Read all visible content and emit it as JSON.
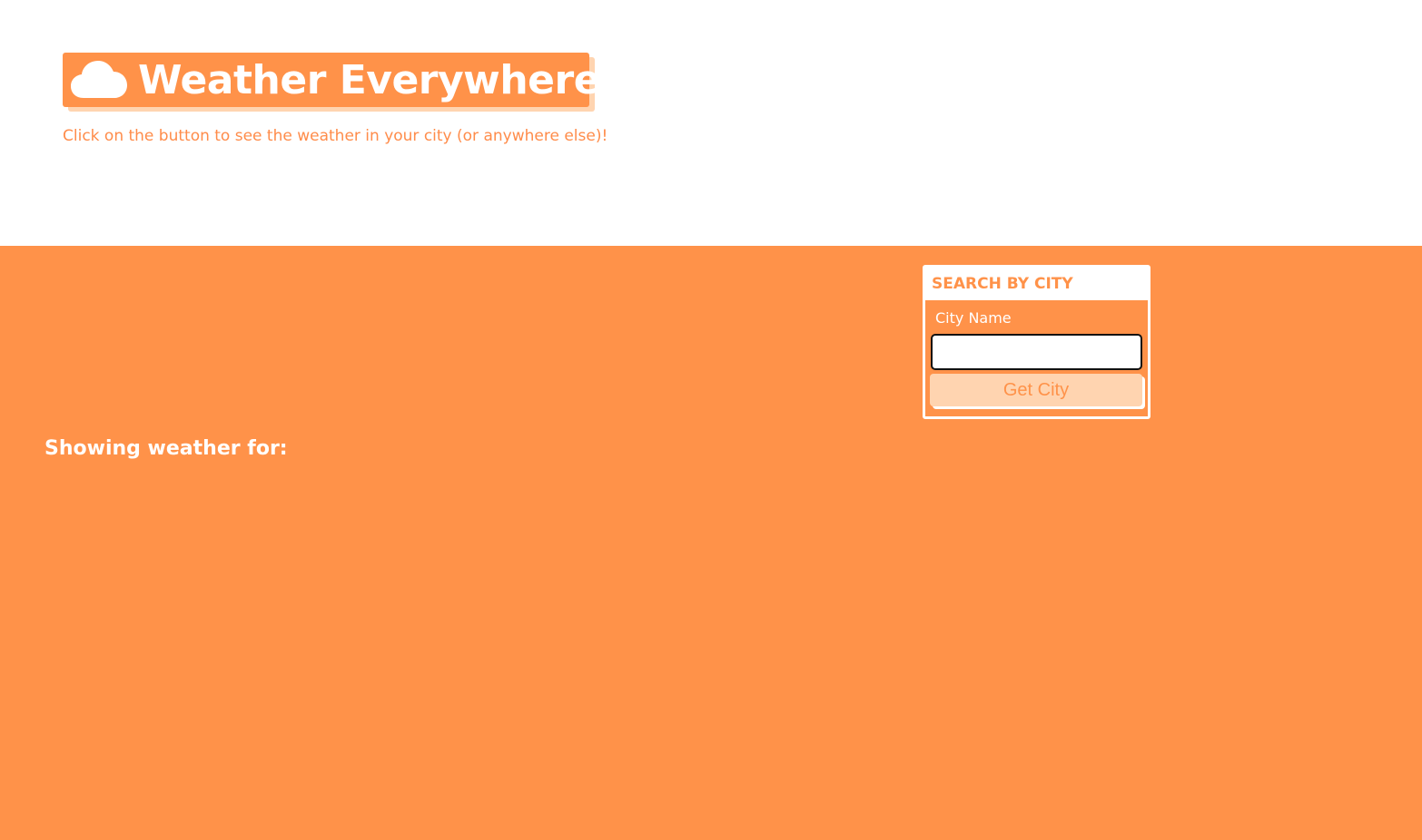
{
  "header": {
    "title": "Weather Everywhere!",
    "subtitle": "Click on the button to see the weather in your city (or anywhere else)!",
    "icon": "cloud-icon"
  },
  "search": {
    "heading": "SEARCH BY CITY",
    "label": "City Name",
    "input_value": "",
    "button_label": "Get City"
  },
  "main": {
    "showing_label": "Showing weather for:"
  },
  "colors": {
    "accent": "#ff9249",
    "accent_light": "#ffd4b0",
    "background": "#ffffff"
  }
}
